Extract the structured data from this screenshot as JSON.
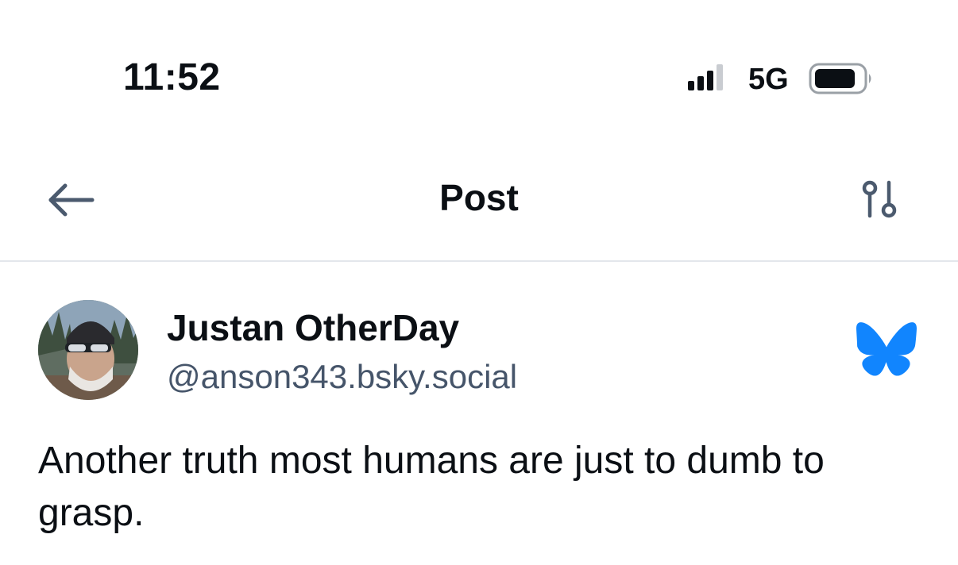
{
  "status_bar": {
    "time": "11:52",
    "network": "5G",
    "signal_icon": "cellular-signal-icon",
    "battery_icon": "battery-icon"
  },
  "header": {
    "title": "Post",
    "back_icon": "arrow-left-icon",
    "settings_icon": "filter-sliders-icon"
  },
  "post": {
    "author": {
      "display_name": "Justan OtherDay",
      "handle": "@anson343.bsky.social"
    },
    "brand_icon": "bluesky-butterfly-icon",
    "text": "Another truth most humans are just to dumb to grasp."
  },
  "colors": {
    "brand": "#1185fe",
    "icon": "#4b5a6e",
    "handle": "#46556a",
    "divider": "#e3e7ec",
    "text": "#0b0f14"
  }
}
